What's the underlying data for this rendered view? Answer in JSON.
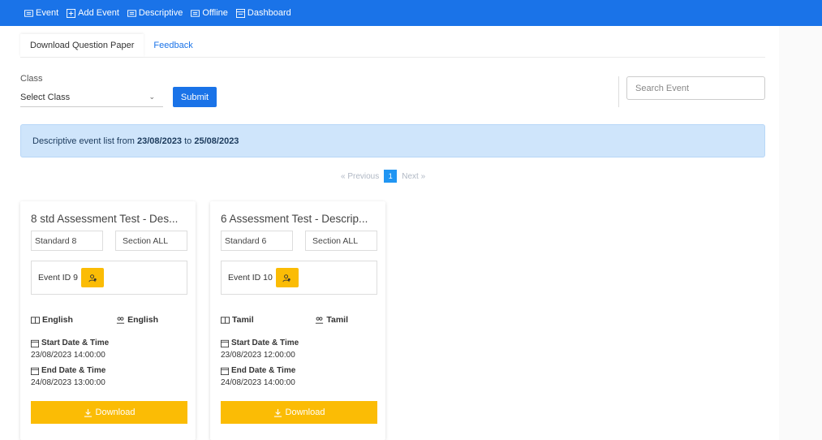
{
  "nav": {
    "items": [
      {
        "label": "Event",
        "icon": "list-icon"
      },
      {
        "label": "Add Event",
        "icon": "add-icon"
      },
      {
        "label": "Descriptive",
        "icon": "list-icon"
      },
      {
        "label": "Offline",
        "icon": "list-icon"
      },
      {
        "label": "Dashboard",
        "icon": "dashboard-icon"
      }
    ]
  },
  "tabs": {
    "download": "Download Question Paper",
    "feedback": "Feedback"
  },
  "filter": {
    "class_label": "Class",
    "class_select_value": "Select Class",
    "submit_label": "Submit",
    "search_placeholder": "Search Event"
  },
  "banner": {
    "prefix": "Descriptive event list from ",
    "from_date": "23/08/2023",
    "mid": " to ",
    "to_date": "25/08/2023"
  },
  "pagination": {
    "previous": "« Previous",
    "page": "1",
    "next": "Next »"
  },
  "cards": [
    {
      "title": "8 std Assessment Test - Des...",
      "standard": "Standard 8",
      "section": "Section ALL",
      "event_id": "Event ID 9",
      "language": "English",
      "medium": "English",
      "start_label": "Start Date & Time",
      "start_value": "23/08/2023 14:00:00",
      "end_label": "End Date & Time",
      "end_value": "24/08/2023 13:00:00",
      "download_label": "Download"
    },
    {
      "title": "6 Assessment Test - Descrip...",
      "standard": "Standard 6",
      "section": "Section ALL",
      "event_id": "Event ID 10",
      "language": "Tamil",
      "medium": "Tamil",
      "start_label": "Start Date & Time",
      "start_value": "23/08/2023 12:00:00",
      "end_label": "End Date & Time",
      "end_value": "24/08/2023 14:00:00",
      "download_label": "Download"
    }
  ],
  "colors": {
    "primary": "#1a73e8",
    "accent": "#fbbc05",
    "banner_bg": "#cfe5fb"
  }
}
